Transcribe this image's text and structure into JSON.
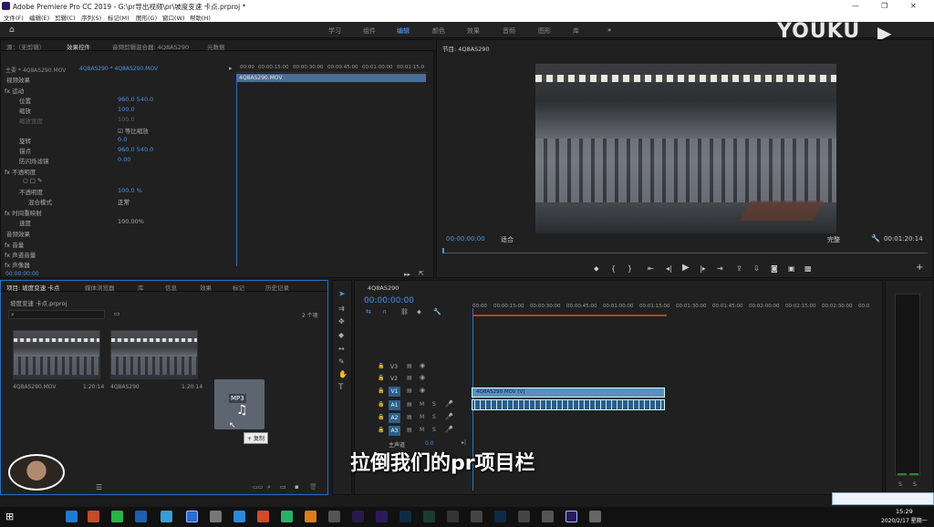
{
  "title_bar": {
    "text": "Adobe Premiere Pro CC 2019 - G:\\pr导出视频\\pr\\坡度变速 卡点.prproj *"
  },
  "menu": [
    "文件(F)",
    "编辑(E)",
    "剪辑(C)",
    "序列(S)",
    "标记(M)",
    "图形(G)",
    "窗口(W)",
    "帮助(H)"
  ],
  "workspaces": [
    "学习",
    "组件",
    "编辑",
    "颜色",
    "效果",
    "音频",
    "图形",
    "库"
  ],
  "workspace_more": "»",
  "logo": "YOUKU",
  "effect_panel": {
    "tabs": [
      "源：（无剪辑）",
      "效果控件",
      "音频剪辑混合器: 4Q8AS290",
      "元数据"
    ],
    "master": "主要 * 4Q8AS290.MOV",
    "clip": "4Q8AS290 * 4Q8AS290.MOV",
    "timecodes": [
      "00:00",
      "00:00:15:00",
      "00:00:30:00",
      "00:00:45:00",
      "00:01:00:00",
      "00:01:15:0"
    ],
    "clip_bar": "4Q8AS290.MOV",
    "video_effects": "视频效果",
    "rows": [
      {
        "label": "fx 运动",
        "value": ""
      },
      {
        "label": "位置",
        "value": "960.0   540.0"
      },
      {
        "label": "缩放",
        "value": "100.0"
      },
      {
        "label": "缩放宽度",
        "value": "100.0"
      },
      {
        "label": "☑ 等比缩放",
        "value": ""
      },
      {
        "label": "旋转",
        "value": "0.0"
      },
      {
        "label": "锚点",
        "value": "960.0   540.0"
      },
      {
        "label": "防闪烁滤镜",
        "value": "0.00"
      },
      {
        "label": "fx 不透明度",
        "value": ""
      },
      {
        "label": "○ □ ✎",
        "value": ""
      },
      {
        "label": "不透明度",
        "value": "100.0 %"
      },
      {
        "label": "混合模式",
        "value": "正常"
      },
      {
        "label": "fx 时间重映射",
        "value": ""
      },
      {
        "label": "速度",
        "value": "100.00%"
      }
    ],
    "audio_effects": "音频效果",
    "audio_rows": [
      "fx 音量",
      "fx 声道音量",
      "fx 声像器"
    ],
    "timecode": "00:00:00:00"
  },
  "program": {
    "title": "节目: 4Q8AS290",
    "timecode": "00:00:00:00",
    "fit": "适合",
    "quality": "完整",
    "duration": "00:01:20:14"
  },
  "project": {
    "tabs": [
      "项目: 坡度变速 卡点",
      "媒体浏览器",
      "库",
      "信息",
      "效果",
      "标记",
      "历史记录"
    ],
    "file": "坡度变速 卡点.prproj",
    "count": "2 个项",
    "items": [
      {
        "name": "4Q8AS290.MOV",
        "dur": "1:20:14"
      },
      {
        "name": "4Q8AS290",
        "dur": "1:20:14"
      }
    ],
    "drag_tile": "MP3",
    "drag_tip": "复制"
  },
  "timeline": {
    "seq": "4Q8AS290",
    "timecode": "00:00:00:00",
    "ruler": [
      "00:00",
      "00:00:15:00",
      "00:00:30:00",
      "00:00:45:00",
      "00:01:00:00",
      "00:01:15:00",
      "00:01:30:00",
      "00:01:45:00",
      "00:02:00:00",
      "00:02:15:00",
      "00:02:30:00",
      "00:0"
    ],
    "tracks": [
      "V3",
      "V2",
      "V1",
      "A1",
      "A2",
      "A3"
    ],
    "master": "主声道",
    "master_val": "0.0",
    "clip_v": "4Q8AS290.MOV [V]"
  },
  "meter": {
    "scale": [
      "S",
      "S"
    ]
  },
  "subtitle": "拉倒我们的pr项目栏",
  "taskbar": {
    "time": "15:29",
    "date": "2020/2/17 星期一"
  }
}
